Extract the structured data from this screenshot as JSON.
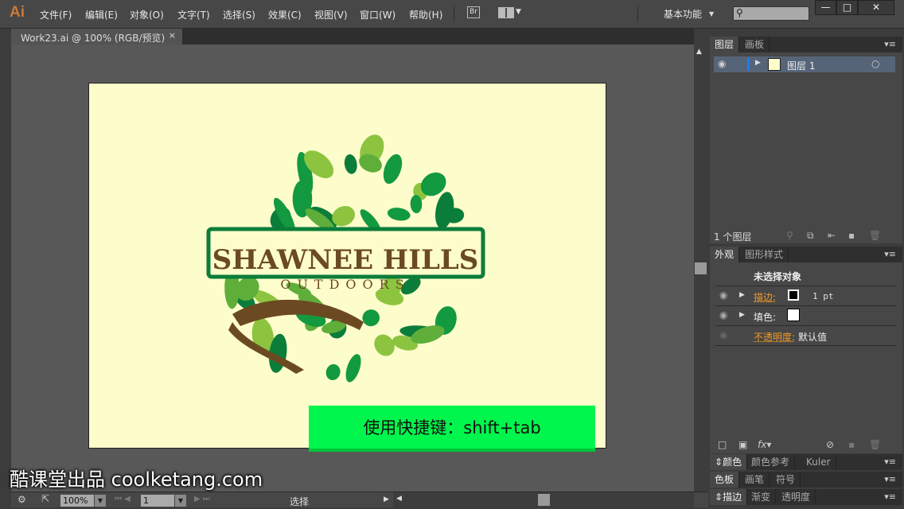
{
  "app": {
    "logo": "Ai",
    "menu": [
      "文件(F)",
      "编辑(E)",
      "对象(O)",
      "文字(T)",
      "选择(S)",
      "效果(C)",
      "视图(V)",
      "窗口(W)",
      "帮助(H)"
    ],
    "bridge": "Br",
    "workspace": "基本功能",
    "window_buttons": [
      "—",
      "□",
      "✕"
    ]
  },
  "document": {
    "tab": "Work23.ai @ 100% (RGB/预览)",
    "close": "×"
  },
  "artwork": {
    "title": "SHAWNEE HILLS",
    "subtitle": "OUTDOORS",
    "leaf_colors": [
      "#0b7d3a",
      "#13993f",
      "#5fae3a",
      "#8cc43f"
    ],
    "trunk_color": "#6b4a22"
  },
  "overlay": {
    "shortcut": "使用快捷键：shift+tab",
    "watermark": "酷课堂出品 coolketang.com"
  },
  "status": {
    "zoom": "100%",
    "page": "1",
    "tool": "选择"
  },
  "layers": {
    "tabs": [
      "图层",
      "画板"
    ],
    "layer_name": "图层 1",
    "count": "1 个图层"
  },
  "appearance": {
    "tabs": [
      "外观",
      "图形样式"
    ],
    "header": "未选择对象",
    "stroke_label": "描边:",
    "stroke_value": "1 pt",
    "fill_label": "填色:",
    "opacity_label": "不透明度:",
    "opacity_value": "默认值"
  },
  "color_panel": {
    "tabs": [
      "颜色",
      "颜色参考",
      "Kuler"
    ]
  },
  "swatch_panel": {
    "tabs": [
      "色板",
      "画笔",
      "符号"
    ]
  },
  "stroke_panel": {
    "tabs": [
      "描边",
      "渐变",
      "透明度"
    ]
  }
}
